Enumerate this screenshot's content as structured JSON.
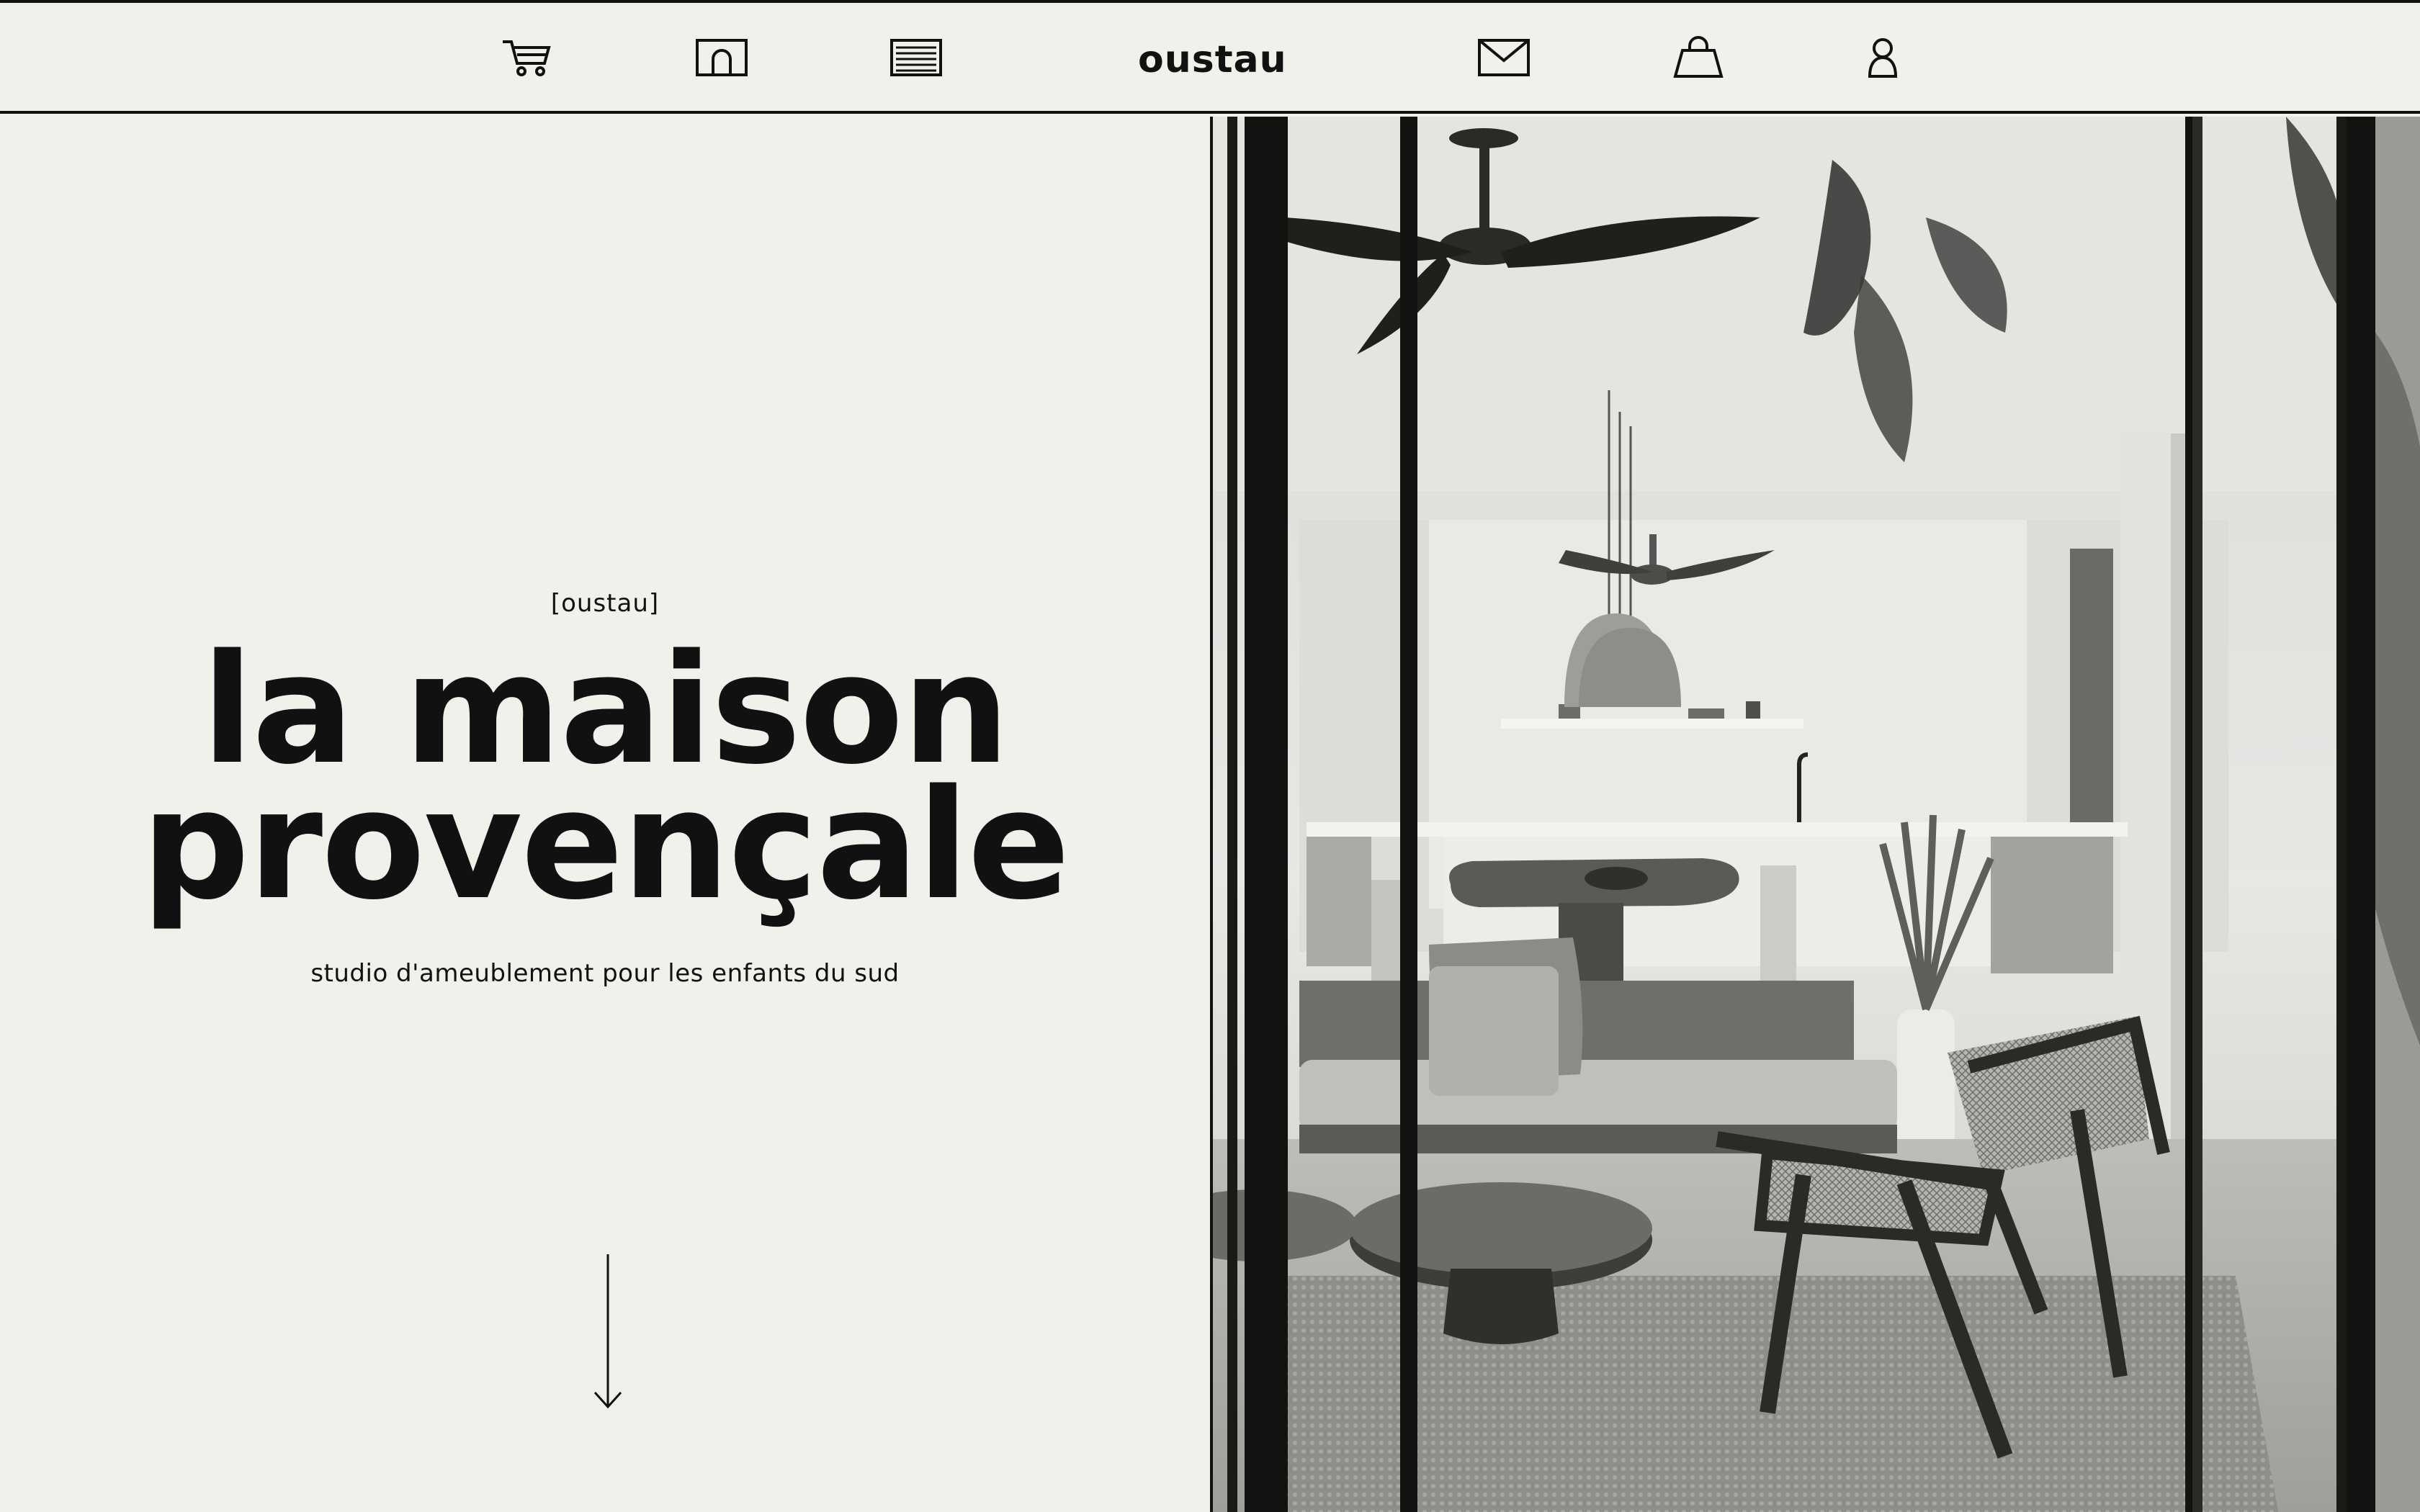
{
  "header": {
    "brand": "oustau",
    "icons": {
      "cart": "cart-icon",
      "arch": "arch-icon",
      "menu": "menu-lines-icon",
      "mail": "mail-icon",
      "bag": "shopping-bag-icon",
      "account": "user-icon"
    }
  },
  "hero": {
    "eyebrow": "[oustau]",
    "headline_line1": "la maison",
    "headline_line2": "provençale",
    "subtitle": "studio d'ameublement pour les enfants du sud",
    "scroll_icon": "arrow-down-icon"
  },
  "photo": {
    "subject": "black-and-white interior photograph"
  },
  "colors": {
    "background": "#f1f0ea",
    "ink": "#111111"
  }
}
